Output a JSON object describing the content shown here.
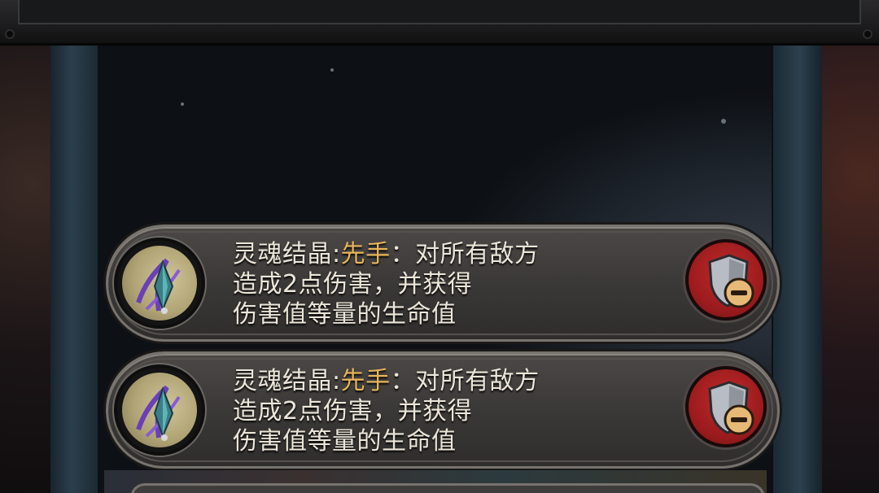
{
  "cards": [
    {
      "portrait_icon": "soul-crystal-icon",
      "text": {
        "prefix": "灵魂结晶:",
        "highlight": "先手",
        "line1_rest": "：对所有敌方",
        "line2": "造成2点伤害，并获得",
        "line3": "伤害值等量的生命值"
      },
      "action_icon": "shield-minus-icon"
    },
    {
      "portrait_icon": "soul-crystal-icon",
      "text": {
        "prefix": "灵魂结晶:",
        "highlight": "先手",
        "line1_rest": "：对所有敌方",
        "line2": "造成2点伤害，并获得",
        "line3": "伤害值等量的生命值"
      },
      "action_icon": "shield-minus-icon"
    }
  ],
  "colors": {
    "highlight": "#e8b55a",
    "text": "#ece6da",
    "badge": "#b02224"
  }
}
